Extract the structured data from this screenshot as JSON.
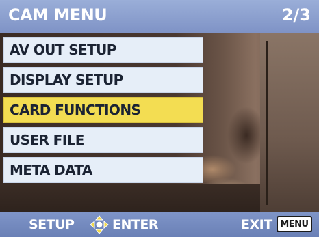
{
  "header": {
    "title": "CAM MENU",
    "page": "2/3"
  },
  "menu": {
    "items": [
      {
        "label": "AV OUT SETUP",
        "selected": false
      },
      {
        "label": "DISPLAY SETUP",
        "selected": false
      },
      {
        "label": "CARD FUNCTIONS",
        "selected": true
      },
      {
        "label": "USER FILE",
        "selected": false
      },
      {
        "label": "META DATA",
        "selected": false
      }
    ]
  },
  "footer": {
    "setup_label": "SETUP",
    "enter_label": "ENTER",
    "exit_label": "EXIT",
    "menu_key_label": "MENU",
    "dpad_icon": "dpad-icon"
  },
  "colors": {
    "header_bg": "#8ea2d0",
    "item_bg": "#e6eef8",
    "selected_bg": "#f3dd52",
    "item_text": "#1b2333"
  }
}
